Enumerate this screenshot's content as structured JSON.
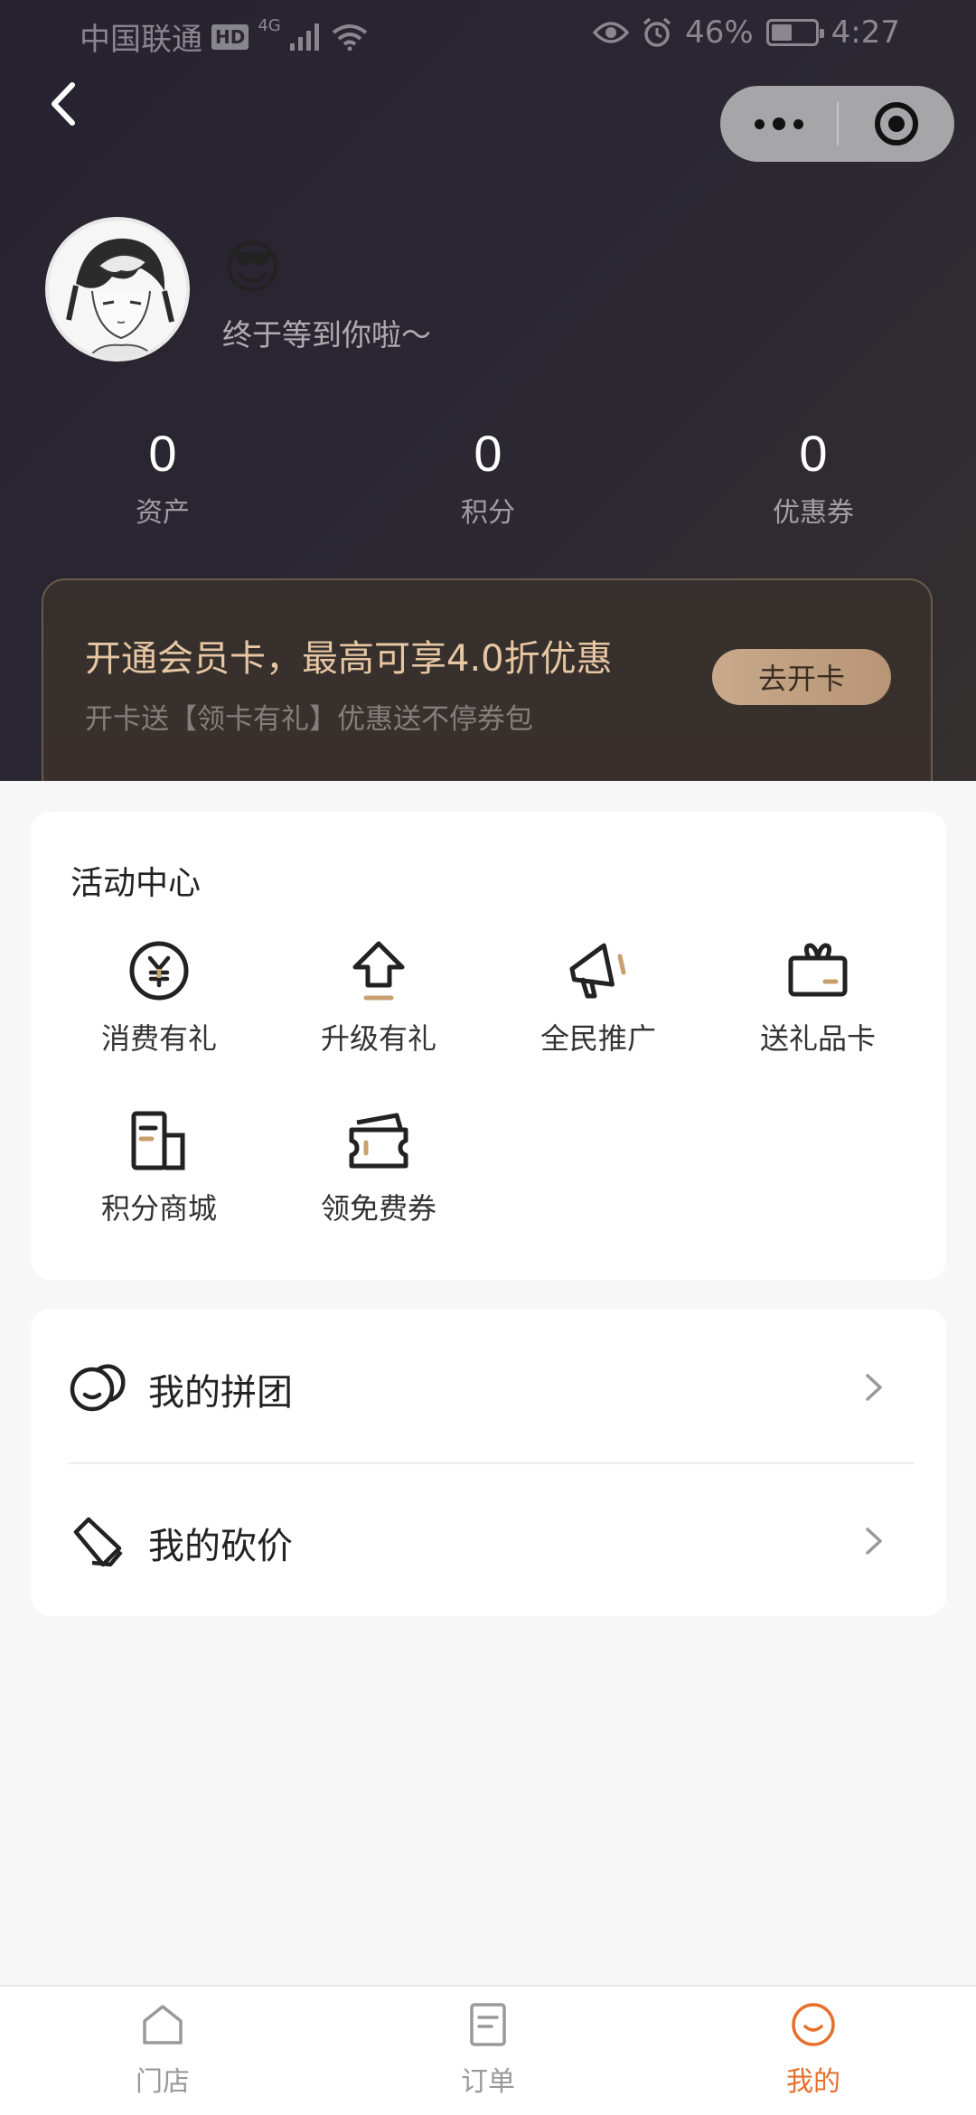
{
  "status_bar": {
    "carrier": "中国联通",
    "hd": "HD",
    "network": "4G",
    "battery": "46%",
    "time": "4:27"
  },
  "profile": {
    "nickname": "😎",
    "greeting": "终于等到你啦～"
  },
  "stats": [
    {
      "value": "0",
      "label": "资产"
    },
    {
      "value": "0",
      "label": "积分"
    },
    {
      "value": "0",
      "label": "优惠券"
    }
  ],
  "member_card": {
    "title": "开通会员卡，最高可享4.0折优惠",
    "subtitle": "开卡送【领卡有礼】优惠送不停券包",
    "button": "去开卡"
  },
  "activity": {
    "title": "活动中心",
    "items": [
      {
        "label": "消费有礼",
        "icon": "yen-coin-icon"
      },
      {
        "label": "升级有礼",
        "icon": "upgrade-arrow-icon"
      },
      {
        "label": "全民推广",
        "icon": "megaphone-icon"
      },
      {
        "label": "送礼品卡",
        "icon": "gift-card-icon"
      },
      {
        "label": "积分商城",
        "icon": "points-mall-icon"
      },
      {
        "label": "领免费券",
        "icon": "coupon-icon"
      }
    ]
  },
  "list": [
    {
      "label": "我的拼团",
      "icon": "group-buy-icon"
    },
    {
      "label": "我的砍价",
      "icon": "bargain-tag-icon"
    }
  ],
  "tabbar": {
    "items": [
      {
        "label": "门店",
        "icon": "store-icon"
      },
      {
        "label": "订单",
        "icon": "order-icon"
      },
      {
        "label": "我的",
        "icon": "smile-icon",
        "active": true
      }
    ],
    "active_color": "#e66f2a",
    "inactive_color": "#999999"
  },
  "colors": {
    "header_bg": "#2a2731",
    "gold": "#e6c6a3",
    "accent": "#c8a98b"
  }
}
